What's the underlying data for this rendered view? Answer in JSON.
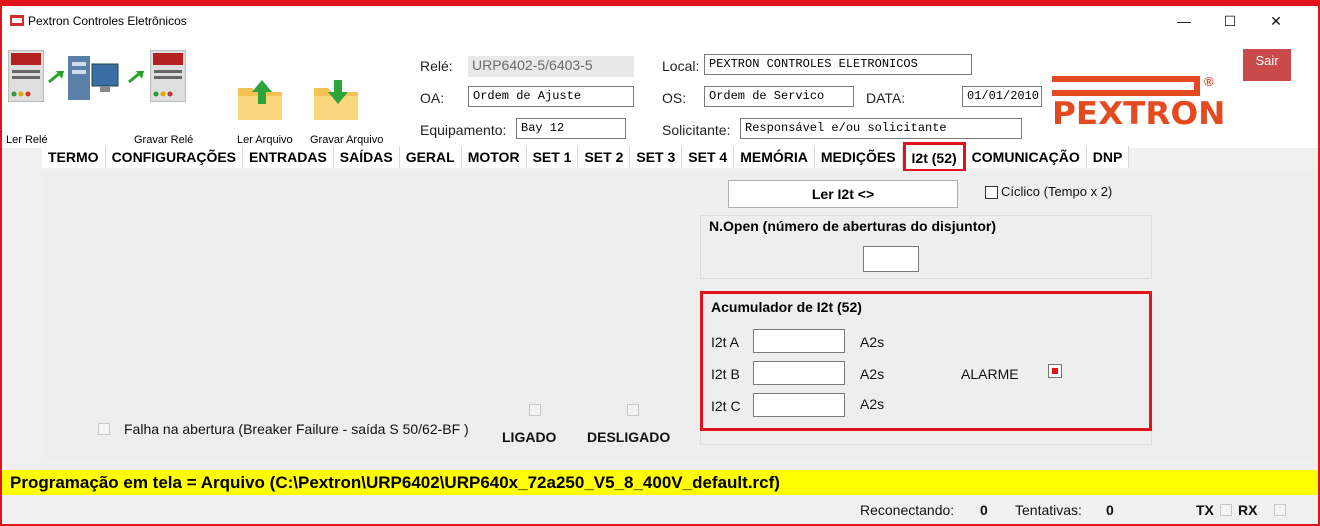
{
  "window": {
    "title": "Pextron Controles Eletrônicos",
    "minimize": "—",
    "maximize": "☐",
    "close": "✕"
  },
  "toolbar": {
    "read_relay": "Ler Relé",
    "write_relay": "Gravar Relé",
    "read_file": "Ler Arquivo",
    "write_file": "Gravar Arquivo"
  },
  "form": {
    "rele_label": "Relé:",
    "rele_value": "URP6402-5/6403-5",
    "oa_label": "OA:",
    "oa_value": "Ordem de Ajuste",
    "equip_label": "Equipamento:",
    "equip_value": "Bay 12",
    "local_label": "Local:",
    "local_value": "PEXTRON CONTROLES ELETRONICOS",
    "os_label": "OS:",
    "os_value": "Ordem de Servico",
    "data_label": "DATA:",
    "data_value": "01/01/2010",
    "solicit_label": "Solicitante:",
    "solicit_value": "Responsável e/ou solicitante"
  },
  "logo": {
    "text": "PEXTRON",
    "reg": "®"
  },
  "sair": "Sair",
  "tabs": [
    "TERMO",
    "CONFIGURAÇÕES",
    "ENTRADAS",
    "SAÍDAS",
    "GERAL",
    "MOTOR",
    "SET 1",
    "SET 2",
    "SET 3",
    "SET 4",
    "MEMÓRIA",
    "MEDIÇÕES",
    "I2t (52)",
    "COMUNICAÇÃO",
    "DNP"
  ],
  "active_tab": "I2t (52)",
  "panel": {
    "read_button": "Ler I2t <>",
    "cyclic_label": "Cíclico (Tempo x 2)",
    "nopen_title": "N.Open (número de aberturas do disjuntor)",
    "nopen_value": "",
    "acc_title": "Acumulador de I2t (52)",
    "rows": [
      {
        "label": "I2t A",
        "value": "",
        "unit": "A2s"
      },
      {
        "label": "I2t B",
        "value": "",
        "unit": "A2s"
      },
      {
        "label": "I2t C",
        "value": "",
        "unit": "A2s"
      }
    ],
    "alarm_label": "ALARME",
    "breaker_failure": "Falha na abertura (Breaker Failure - saída S 50/62-BF )",
    "ligado": "LIGADO",
    "desligado": "DESLIGADO"
  },
  "status_bar": "Programação em tela = Arquivo (C:\\Pextron\\URP6402\\URP640x_72a250_V5_8_400V_default.rcf)",
  "bottom": {
    "reconnect_label": "Reconectando:",
    "reconnect_value": "0",
    "tries_label": "Tentativas:",
    "tries_value": "0",
    "tx": "TX",
    "rx": "RX"
  },
  "colors": {
    "accent_red": "#e0141b",
    "logo_red": "#e34a1f",
    "status_yellow": "#ffff00",
    "alarm_red": "#e0141b"
  },
  "icons": [
    "app-icon",
    "relay-device-icon",
    "computer-icon",
    "arrow-icon",
    "folder-up-icon",
    "folder-down-icon"
  ]
}
